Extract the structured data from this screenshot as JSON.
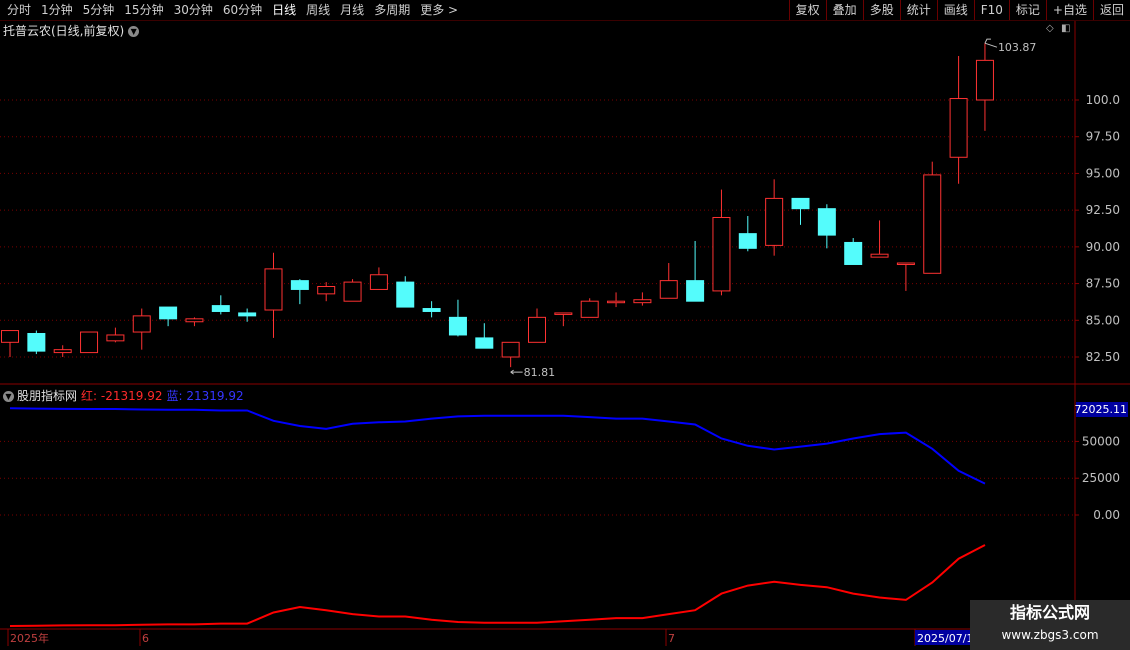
{
  "toolbar": {
    "periods": [
      "分时",
      "1分钟",
      "5分钟",
      "15分钟",
      "30分钟",
      "60分钟",
      "日线",
      "周线",
      "月线",
      "多周期",
      "更多 >"
    ],
    "active_index": 6,
    "right_buttons": [
      "复权",
      "叠加",
      "多股",
      "统计",
      "画线",
      "F10",
      "标记",
      "+自选",
      "返回"
    ]
  },
  "stock": {
    "title": "托普云农(日线,前复权)"
  },
  "price_axis": {
    "labels": [
      "100.0",
      "97.50",
      "95.00",
      "92.50",
      "90.00",
      "87.50",
      "85.00",
      "82.50"
    ],
    "values": [
      100,
      97.5,
      95,
      92.5,
      90,
      87.5,
      85,
      82.5
    ],
    "range": [
      81.0,
      104.5
    ]
  },
  "annotations": {
    "high": "103.87",
    "low": "81.81"
  },
  "indicator": {
    "name": "股朋指标网",
    "red_label": "红: -21319.92",
    "blue_label": "蓝: 21319.92",
    "axis_labels": [
      "72025.11",
      "50000",
      "25000",
      "0.00"
    ],
    "axis_values": [
      72025.11,
      50000,
      25000,
      0
    ]
  },
  "dates": {
    "labels": [
      "2025年",
      "6",
      "7",
      "2025/07/1"
    ]
  },
  "watermark": {
    "line1": "指标公式网",
    "line2": "www.zbgs3.com"
  },
  "colors": {
    "up": "#ff3232",
    "down": "#54fcfc",
    "blue_line": "#0000ff",
    "red_line": "#ff0000",
    "grid": "#7a0000"
  },
  "chart_data": {
    "type": "candlestick",
    "candles": [
      {
        "o": 83.5,
        "h": 84.3,
        "l": 82.5,
        "c": 84.3
      },
      {
        "o": 84.1,
        "h": 84.3,
        "l": 82.7,
        "c": 82.9
      },
      {
        "o": 82.8,
        "h": 83.3,
        "l": 82.5,
        "c": 83.0
      },
      {
        "o": 82.8,
        "h": 84.2,
        "l": 82.8,
        "c": 84.2
      },
      {
        "o": 83.6,
        "h": 84.5,
        "l": 83.5,
        "c": 84.0
      },
      {
        "o": 84.2,
        "h": 85.8,
        "l": 83.0,
        "c": 85.3
      },
      {
        "o": 85.9,
        "h": 85.9,
        "l": 84.6,
        "c": 85.1
      },
      {
        "o": 84.9,
        "h": 85.2,
        "l": 84.6,
        "c": 85.1
      },
      {
        "o": 86.0,
        "h": 86.7,
        "l": 85.4,
        "c": 85.6
      },
      {
        "o": 85.5,
        "h": 85.8,
        "l": 84.9,
        "c": 85.3
      },
      {
        "o": 85.7,
        "h": 89.6,
        "l": 83.8,
        "c": 88.5
      },
      {
        "o": 87.7,
        "h": 87.8,
        "l": 86.1,
        "c": 87.1
      },
      {
        "o": 86.8,
        "h": 87.6,
        "l": 86.3,
        "c": 87.3
      },
      {
        "o": 86.3,
        "h": 87.8,
        "l": 86.3,
        "c": 87.6
      },
      {
        "o": 87.1,
        "h": 88.6,
        "l": 87.1,
        "c": 88.1
      },
      {
        "o": 87.6,
        "h": 88.0,
        "l": 85.9,
        "c": 85.9
      },
      {
        "o": 85.8,
        "h": 86.3,
        "l": 85.2,
        "c": 85.6
      },
      {
        "o": 85.2,
        "h": 86.4,
        "l": 83.9,
        "c": 84.0
      },
      {
        "o": 83.8,
        "h": 84.8,
        "l": 83.1,
        "c": 83.1
      },
      {
        "o": 82.5,
        "h": 83.5,
        "l": 81.81,
        "c": 83.5
      },
      {
        "o": 83.5,
        "h": 85.8,
        "l": 83.5,
        "c": 85.2
      },
      {
        "o": 85.5,
        "h": 85.5,
        "l": 84.6,
        "c": 85.5
      },
      {
        "o": 85.2,
        "h": 86.5,
        "l": 85.2,
        "c": 86.3
      },
      {
        "o": 86.2,
        "h": 86.9,
        "l": 85.9,
        "c": 86.3
      },
      {
        "o": 86.2,
        "h": 86.9,
        "l": 86.0,
        "c": 86.4
      },
      {
        "o": 86.5,
        "h": 88.9,
        "l": 86.5,
        "c": 87.7
      },
      {
        "o": 87.7,
        "h": 90.4,
        "l": 86.3,
        "c": 86.3
      },
      {
        "o": 87.0,
        "h": 93.9,
        "l": 86.7,
        "c": 92.0
      },
      {
        "o": 90.9,
        "h": 92.1,
        "l": 89.7,
        "c": 89.9
      },
      {
        "o": 90.1,
        "h": 94.6,
        "l": 89.4,
        "c": 93.3
      },
      {
        "o": 93.3,
        "h": 93.3,
        "l": 91.5,
        "c": 92.6
      },
      {
        "o": 92.6,
        "h": 92.9,
        "l": 89.9,
        "c": 90.8
      },
      {
        "o": 90.3,
        "h": 90.6,
        "l": 88.8,
        "c": 88.8
      },
      {
        "o": 89.3,
        "h": 91.8,
        "l": 89.3,
        "c": 89.5
      },
      {
        "o": 88.9,
        "h": 88.9,
        "l": 87.0,
        "c": 88.9
      },
      {
        "o": 88.2,
        "h": 95.8,
        "l": 88.2,
        "c": 94.9
      },
      {
        "o": 96.1,
        "h": 103.0,
        "l": 94.3,
        "c": 100.1
      },
      {
        "o": 100.0,
        "h": 103.87,
        "l": 97.9,
        "c": 102.7
      }
    ],
    "blue_series": [
      72500,
      72300,
      72100,
      72000,
      72000,
      71700,
      71500,
      71500,
      71000,
      71000,
      64000,
      60500,
      58500,
      62000,
      63000,
      63500,
      65500,
      67000,
      67500,
      67500,
      67500,
      67500,
      66500,
      65500,
      65500,
      63500,
      61500,
      52000,
      47000,
      44500,
      46500,
      48500,
      52000,
      55000,
      56000,
      45000,
      30000,
      21319.92
    ],
    "red_series": [
      -72500,
      -72300,
      -72100,
      -72000,
      -72000,
      -71700,
      -71500,
      -71500,
      -71000,
      -71000,
      -64000,
      -60500,
      -62500,
      -65000,
      -66500,
      -66500,
      -68500,
      -70000,
      -70500,
      -70500,
      -70500,
      -69500,
      -68500,
      -67500,
      -67500,
      -65000,
      -62500,
      -52000,
      -47000,
      -44500,
      -46500,
      -48000,
      -52000,
      -54500,
      -56000,
      -45000,
      -30000,
      -21319.92
    ]
  }
}
